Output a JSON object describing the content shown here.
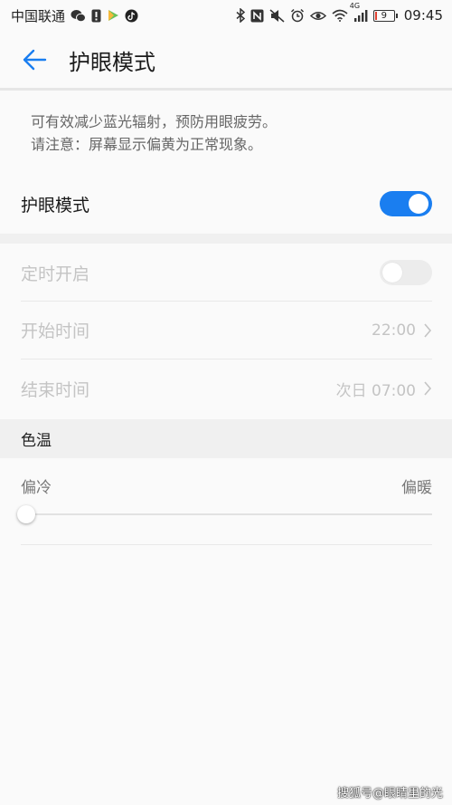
{
  "status_bar": {
    "carrier": "中国联通",
    "battery_level": "9",
    "battery_fraction": 0.09,
    "network_label": "4G",
    "time": "09:45",
    "icons": [
      "wechat-icon",
      "alert-icon",
      "play-icon",
      "tiktok-icon",
      "bluetooth-icon",
      "nfc-icon",
      "mute-icon",
      "alarm-icon",
      "eye-icon",
      "wifi-icon",
      "signal-icon",
      "battery-icon"
    ]
  },
  "header": {
    "back_icon": "back-arrow-icon",
    "title": "护眼模式"
  },
  "description": {
    "line1": "可有效减少蓝光辐射，预防用眼疲劳。",
    "line2": "请注意：屏幕显示偏黄为正常现象。"
  },
  "eye_mode": {
    "label": "护眼模式",
    "enabled": true
  },
  "schedule": {
    "timer_label": "定时开启",
    "timer_enabled": false,
    "start_label": "开始时间",
    "start_value": "22:00",
    "end_label": "结束时间",
    "end_value": "次日 07:00"
  },
  "color_temp": {
    "title": "色温",
    "min_label": "偏冷",
    "max_label": "偏暖",
    "value_fraction": 0.0
  },
  "watermark": "搜狐号@眼睛里的光",
  "colors": {
    "accent": "#1a7ef0",
    "disabled_text": "#c4c4c4",
    "section_bg": "#f0f0f0"
  }
}
